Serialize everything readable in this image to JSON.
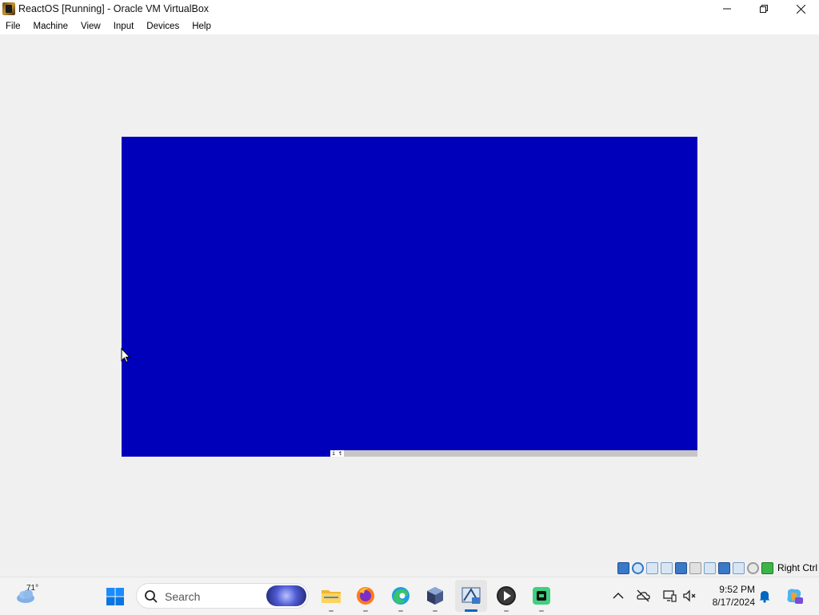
{
  "window": {
    "title": "ReactOS [Running] - Oracle VM VirtualBox"
  },
  "menu": {
    "items": [
      "File",
      "Machine",
      "View",
      "Input",
      "Devices",
      "Help"
    ]
  },
  "vm": {
    "screen_color": "#0000bb",
    "status_text": "i t"
  },
  "vbox_status": {
    "host_key_label": "Right Ctrl",
    "icons": [
      "hard-disk-icon",
      "optical-drive-icon",
      "audio-icon",
      "network-icon",
      "usb-icon",
      "shared-folders-icon",
      "display-icon",
      "video-capture-icon",
      "cpu-icon",
      "mouse-integration-icon",
      "host-key-icon"
    ]
  },
  "taskbar": {
    "weather_temp": "71°",
    "search_placeholder": "Search",
    "apps": [
      "file-explorer",
      "firefox",
      "edge",
      "virtualbox",
      "reactos-vm",
      "media-player",
      "terminal"
    ],
    "active_app": "reactos-vm",
    "clock_time": "9:52 PM",
    "clock_date": "8/17/2024",
    "accent": "#0067c0"
  }
}
